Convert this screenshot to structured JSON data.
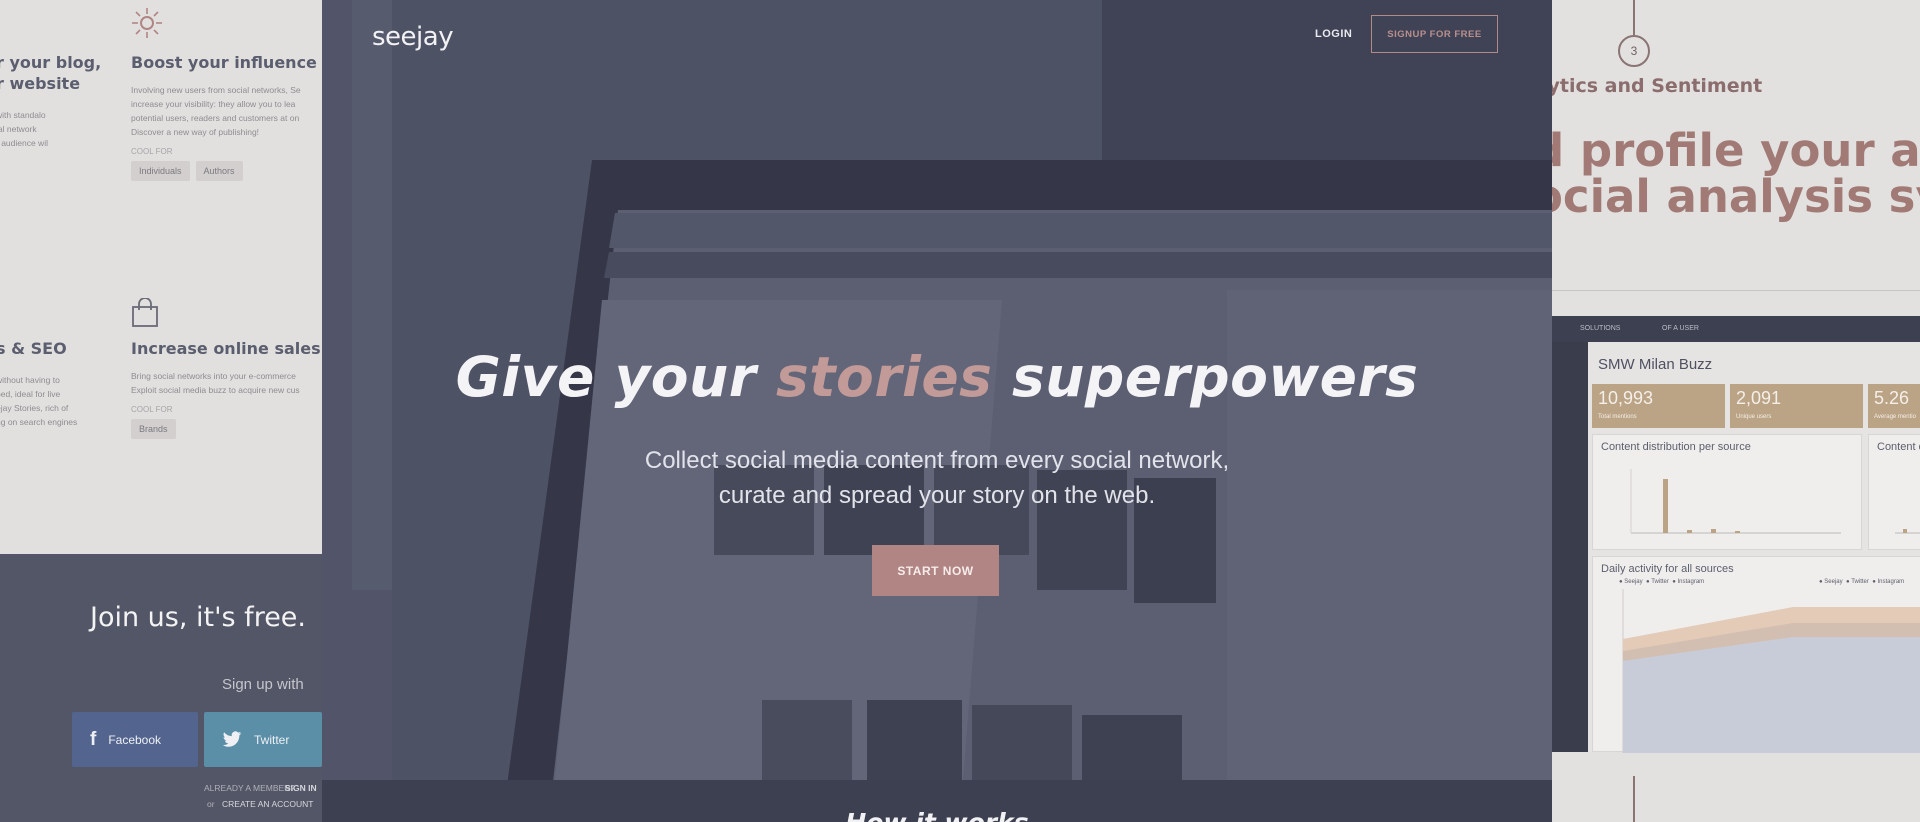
{
  "left": {
    "features": [
      {
        "title_line1": "r your blog,",
        "title_line2": "r website",
        "desc": [
          "with standalo",
          "ial network",
          "r audience wil"
        ]
      },
      {
        "title": "Boost your influence",
        "desc": [
          "Involving new users from social networks, Se",
          "increase your visibility: they allow you to lea",
          "potential users, readers and customers at on",
          "Discover a new way of publishing!"
        ],
        "cool_for": "COOL FOR",
        "chips": [
          "Individuals",
          "Authors"
        ]
      },
      {
        "title": "s & SEO",
        "desc": [
          "without having to",
          "bed, ideal for live",
          "ejay Stories, rich of",
          "ng on search engines"
        ]
      },
      {
        "title": "Increase online sales",
        "desc": [
          "Bring social networks into your e-commerce",
          "Exploit social media buzz to acquire new cus"
        ],
        "cool_for": "COOL FOR",
        "chips": [
          "Brands"
        ]
      }
    ],
    "join": "Join us, it's free.",
    "signup_with": "Sign up with",
    "facebook": "Facebook",
    "twitter": "Twitter",
    "already_text": "ALREADY A MEMBER?",
    "sign_in": "SIGN IN",
    "or_text": "or",
    "create_account": "CREATE AN ACCOUNT"
  },
  "hero": {
    "logo": "seejay",
    "login": "LOGIN",
    "signup_free": "SIGNUP FOR FREE",
    "headline_pre": "Give your ",
    "headline_accent": "stories",
    "headline_post": " superpowers",
    "sub_line1": "Collect social media content from every social network,",
    "sub_line2": "curate and spread your story on the web.",
    "cta": "START NOW",
    "how": "How it works"
  },
  "right": {
    "step": "3",
    "subtitle": "lytics and Sentiment",
    "big_line1": "d profile your aud",
    "big_line2": "ocial analysis sys",
    "dash": {
      "tab1": "SOLUTIONS",
      "tab2": "OF A USER",
      "title": "SMW Milan Buzz",
      "stats": [
        {
          "num": "10,993",
          "lbl": "Total mentions"
        },
        {
          "num": "2,091",
          "lbl": "Unique users"
        },
        {
          "num": "5.26",
          "lbl": "Average mentio"
        }
      ],
      "card1": "Content distribution per source",
      "card2": "Content di",
      "card3": "Daily activity for all sources",
      "legend": [
        "Seejay",
        "Twitter",
        "Instagram"
      ],
      "legend2": [
        "Seejay",
        "Twitter",
        "Instagram"
      ]
    }
  },
  "colors": {
    "accent": "#b08583",
    "hero_overlay": "#52566a",
    "dash_bar": "#bba386"
  }
}
